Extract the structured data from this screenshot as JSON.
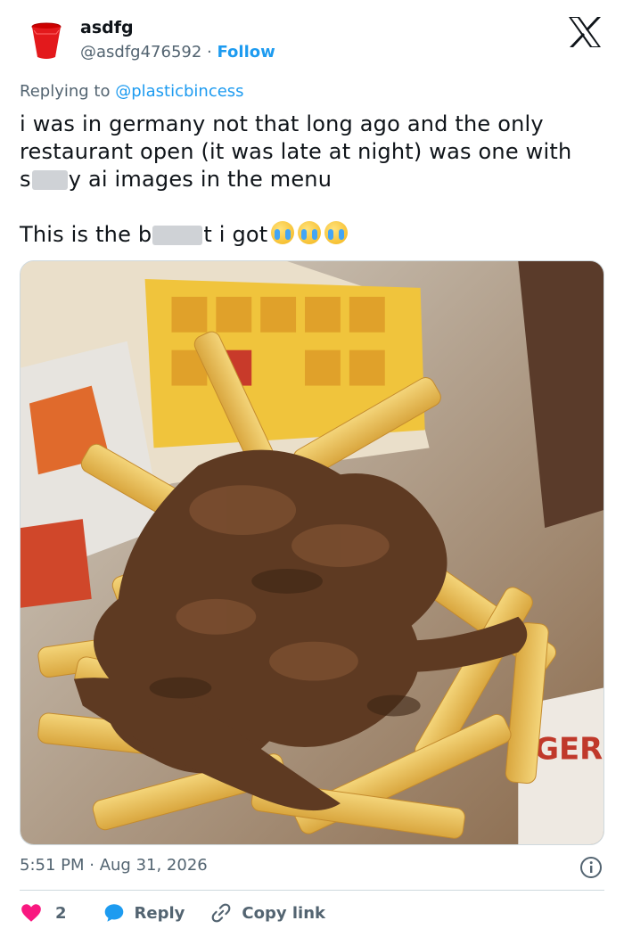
{
  "author": {
    "name": "asdfg",
    "handle": "@asdfg476592",
    "separator": " · ",
    "follow_label": "Follow"
  },
  "reply_context": {
    "prefix": "Replying to ",
    "mention": "@plasticbincess"
  },
  "tweet": {
    "line1": "i was in germany not that long ago and the only restaurant open (it was late at night) was one with",
    "line2_start": "s",
    "line2_end": "y ai images in the menu",
    "line3_start": "This is the b",
    "line3_end": "t i got"
  },
  "meta": {
    "time": "5:51 PM",
    "separator": " · ",
    "date": "Aug 31, 2026"
  },
  "actions": {
    "like_count": "2",
    "reply_label": "Reply",
    "copy_label": "Copy link"
  },
  "icons": {
    "avatar": "red-cup-icon",
    "brand": "x-logo-icon",
    "emoji": "loudly-crying-face-icon",
    "like": "heart-icon",
    "reply": "speech-bubble-icon",
    "copy": "link-icon",
    "info": "info-icon"
  },
  "colors": {
    "accent": "#1d9bf0",
    "secondary_text": "#536471",
    "like": "#f91880",
    "divider": "#cfd9de"
  }
}
